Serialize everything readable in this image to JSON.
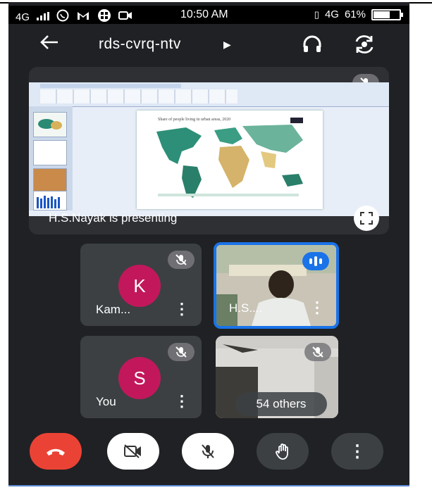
{
  "status_bar": {
    "network_left": "4G",
    "time": "10:50 AM",
    "network_right": "4G",
    "battery": "61%",
    "battery_level": 0.61
  },
  "meeting": {
    "code": "rds-cvrq-ntv",
    "presenting_label": "H.S.Nayak is presenting"
  },
  "participants": [
    {
      "initial": "K",
      "name": "Kam...",
      "muted": true,
      "avatar_color": "#c2185b"
    },
    {
      "name": "H.S....",
      "speaking": true,
      "highlight_color": "#1a73e8"
    },
    {
      "initial": "S",
      "name": "You",
      "muted": true,
      "avatar_color": "#c2185b"
    },
    {
      "others_label": "54 others",
      "muted": true
    }
  ],
  "slide": {
    "title": "Share of people living in urban areas, 2020"
  },
  "colors": {
    "background": "#202124",
    "tile": "#3c4043",
    "end_call": "#ea4335",
    "accent": "#1a73e8"
  },
  "icons": [
    "back-arrow-icon",
    "headphones-icon",
    "switch-camera-icon",
    "mic-off-icon",
    "fullscreen-icon",
    "more-vert-icon",
    "phone-hangup-icon",
    "camera-off-icon",
    "raise-hand-icon",
    "speaking-bars-icon"
  ]
}
